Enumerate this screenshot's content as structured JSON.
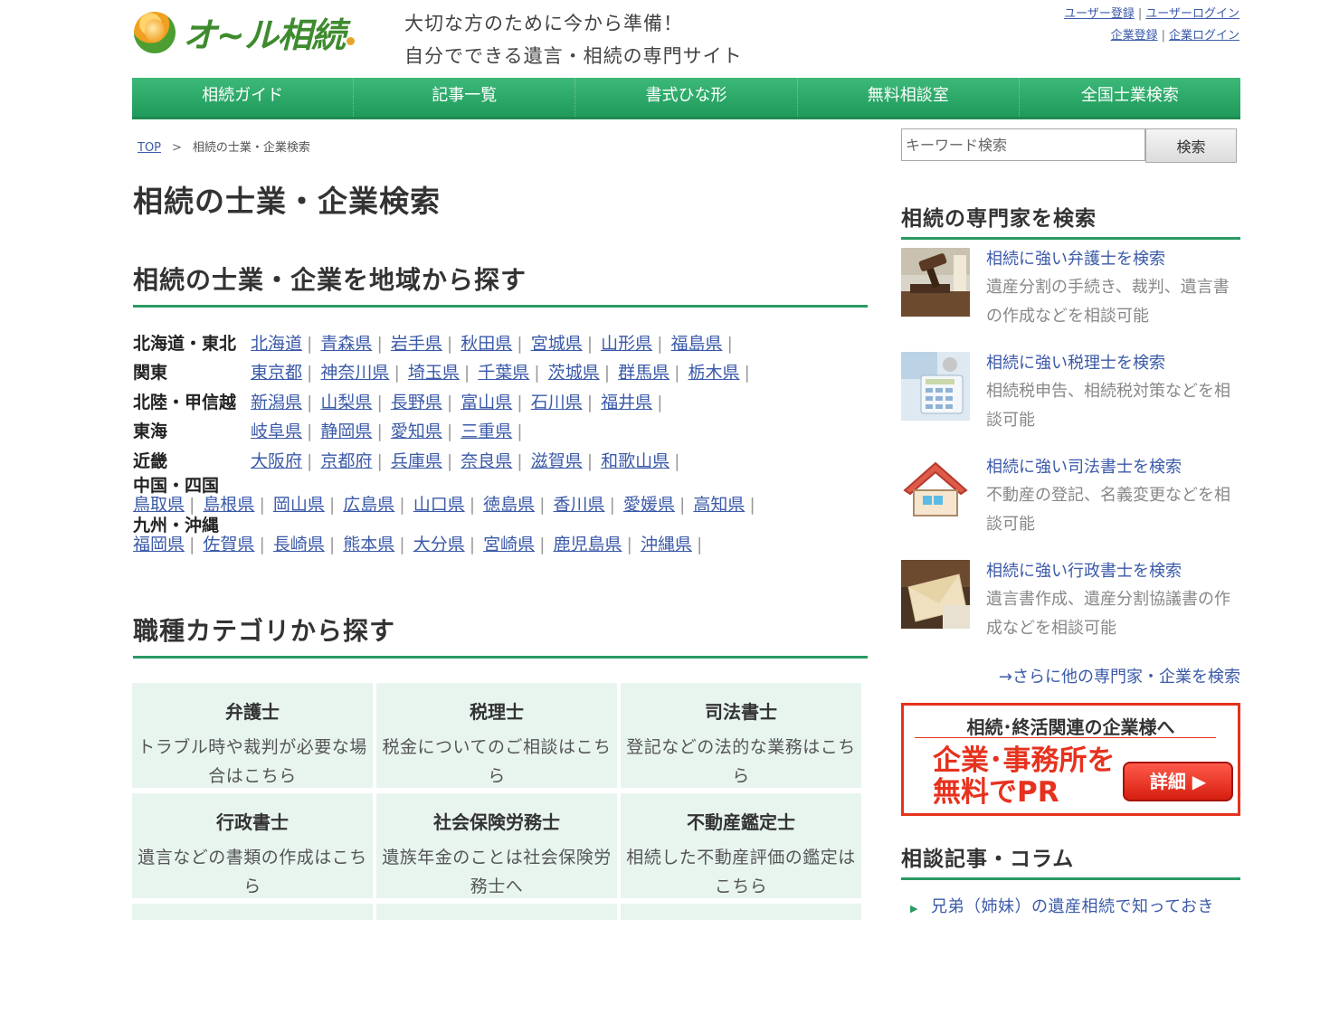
{
  "header": {
    "logo_text": "オ~ル相続",
    "tagline_line1": "大切な方のために今から準備！",
    "tagline_line2": "自分でできる遺言・相続の専門サイト",
    "user_register": "ユーザー登録",
    "user_login": "ユーザーログイン",
    "company_register": "企業登録",
    "company_login": "企業ログイン",
    "separator": "|"
  },
  "nav": [
    "相続ガイド",
    "記事一覧",
    "書式ひな形",
    "無料相談室",
    "全国士業検索"
  ],
  "breadcrumb": {
    "top": "TOP",
    "sep": ">",
    "current": "相続の士業・企業検索"
  },
  "main": {
    "title": "相続の士業・企業検索",
    "region_heading": "相続の士業・企業を地域から探す",
    "regions": [
      {
        "name": "北海道・東北",
        "prefs": [
          "北海道",
          "青森県",
          "岩手県",
          "秋田県",
          "宮城県",
          "山形県",
          "福島県"
        ]
      },
      {
        "name": "関東",
        "prefs": [
          "東京都",
          "神奈川県",
          "埼玉県",
          "千葉県",
          "茨城県",
          "群馬県",
          "栃木県"
        ]
      },
      {
        "name": "北陸・甲信越",
        "prefs": [
          "新潟県",
          "山梨県",
          "長野県",
          "富山県",
          "石川県",
          "福井県"
        ]
      },
      {
        "name": "東海",
        "prefs": [
          "岐阜県",
          "静岡県",
          "愛知県",
          "三重県"
        ]
      },
      {
        "name": "近畿",
        "prefs": [
          "大阪府",
          "京都府",
          "兵庫県",
          "奈良県",
          "滋賀県",
          "和歌山県"
        ]
      },
      {
        "name": "中国・四国",
        "prefs": [
          "鳥取県",
          "島根県",
          "岡山県",
          "広島県",
          "山口県",
          "徳島県",
          "香川県",
          "愛媛県",
          "高知県"
        ]
      },
      {
        "name": "九州・沖縄",
        "prefs": [
          "福岡県",
          "佐賀県",
          "長崎県",
          "熊本県",
          "大分県",
          "宮崎県",
          "鹿児島県",
          "沖縄県"
        ]
      }
    ],
    "category_heading": "職種カテゴリから探す",
    "categories": [
      {
        "title": "弁護士",
        "desc": "トラブル時や裁判が必要な場合はこちら"
      },
      {
        "title": "税理士",
        "desc": "税金についてのご相談はこちら"
      },
      {
        "title": "司法書士",
        "desc": "登記などの法的な業務はこちら"
      },
      {
        "title": "行政書士",
        "desc": "遺言などの書類の作成はこちら"
      },
      {
        "title": "社会保険労務士",
        "desc": "遺族年金のことは社会保険労務士へ"
      },
      {
        "title": "不動産鑑定士",
        "desc": "相続した不動産評価の鑑定はこちら"
      }
    ]
  },
  "sidebar": {
    "search_placeholder": "キーワード検索",
    "search_button": "検索",
    "experts_heading": "相続の専門家を検索",
    "experts": [
      {
        "title": "相続に強い弁護士を検索",
        "desc": "遺産分割の手続き、裁判、遺言書の作成などを相談可能",
        "icon": "gavel-image"
      },
      {
        "title": "相続に強い税理士を検索",
        "desc": "相続税申告、相続税対策などを相談可能",
        "icon": "calculator-image"
      },
      {
        "title": "相続に強い司法書士を検索",
        "desc": "不動産の登記、名義変更などを相談可能",
        "icon": "house-icon"
      },
      {
        "title": "相続に強い行政書士を検索",
        "desc": "遺言書作成、遺産分割協議書の作成などを相談可能",
        "icon": "envelope-image"
      }
    ],
    "more_link": "→さらに他の専門家・企業を検索",
    "banner": {
      "top": "相続･終活関連の企業様へ",
      "main_line1": "企業･事務所を",
      "main_line2": "無料でPR",
      "button": "詳細 ▶"
    },
    "column_heading": "相談記事・コラム",
    "column_items": [
      "兄弟（姉妹）の遺産相続で知っておき"
    ]
  },
  "colors": {
    "accent_green": "#2a9a63",
    "link_blue": "#3b5aa8",
    "banner_red": "#e6321e",
    "category_bg": "#e8f5ef"
  }
}
